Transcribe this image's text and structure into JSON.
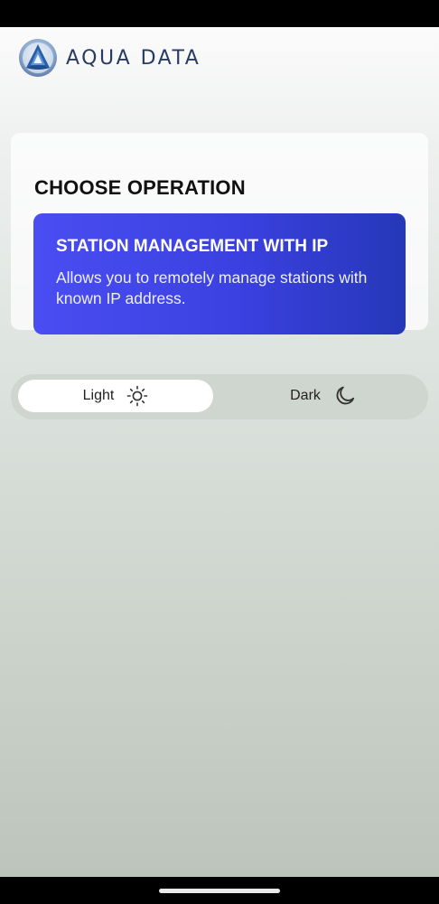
{
  "header": {
    "brand_name": "AQUA DATA",
    "logo_icon": "aqua-data-logo"
  },
  "operations": {
    "title": "CHOOSE OPERATION",
    "items": [
      {
        "title": "STATION MANAGEMENT WITH IP",
        "description": "Allows you to remotely manage stations with known IP address."
      }
    ]
  },
  "theme": {
    "selected": "light",
    "options": [
      {
        "label": "Light",
        "icon": "sun-icon"
      },
      {
        "label": "Dark",
        "icon": "moon-icon"
      }
    ]
  },
  "colors": {
    "card_start": "#4a4ef2",
    "card_end": "#2538b8",
    "brand_text": "#2a3b63"
  }
}
